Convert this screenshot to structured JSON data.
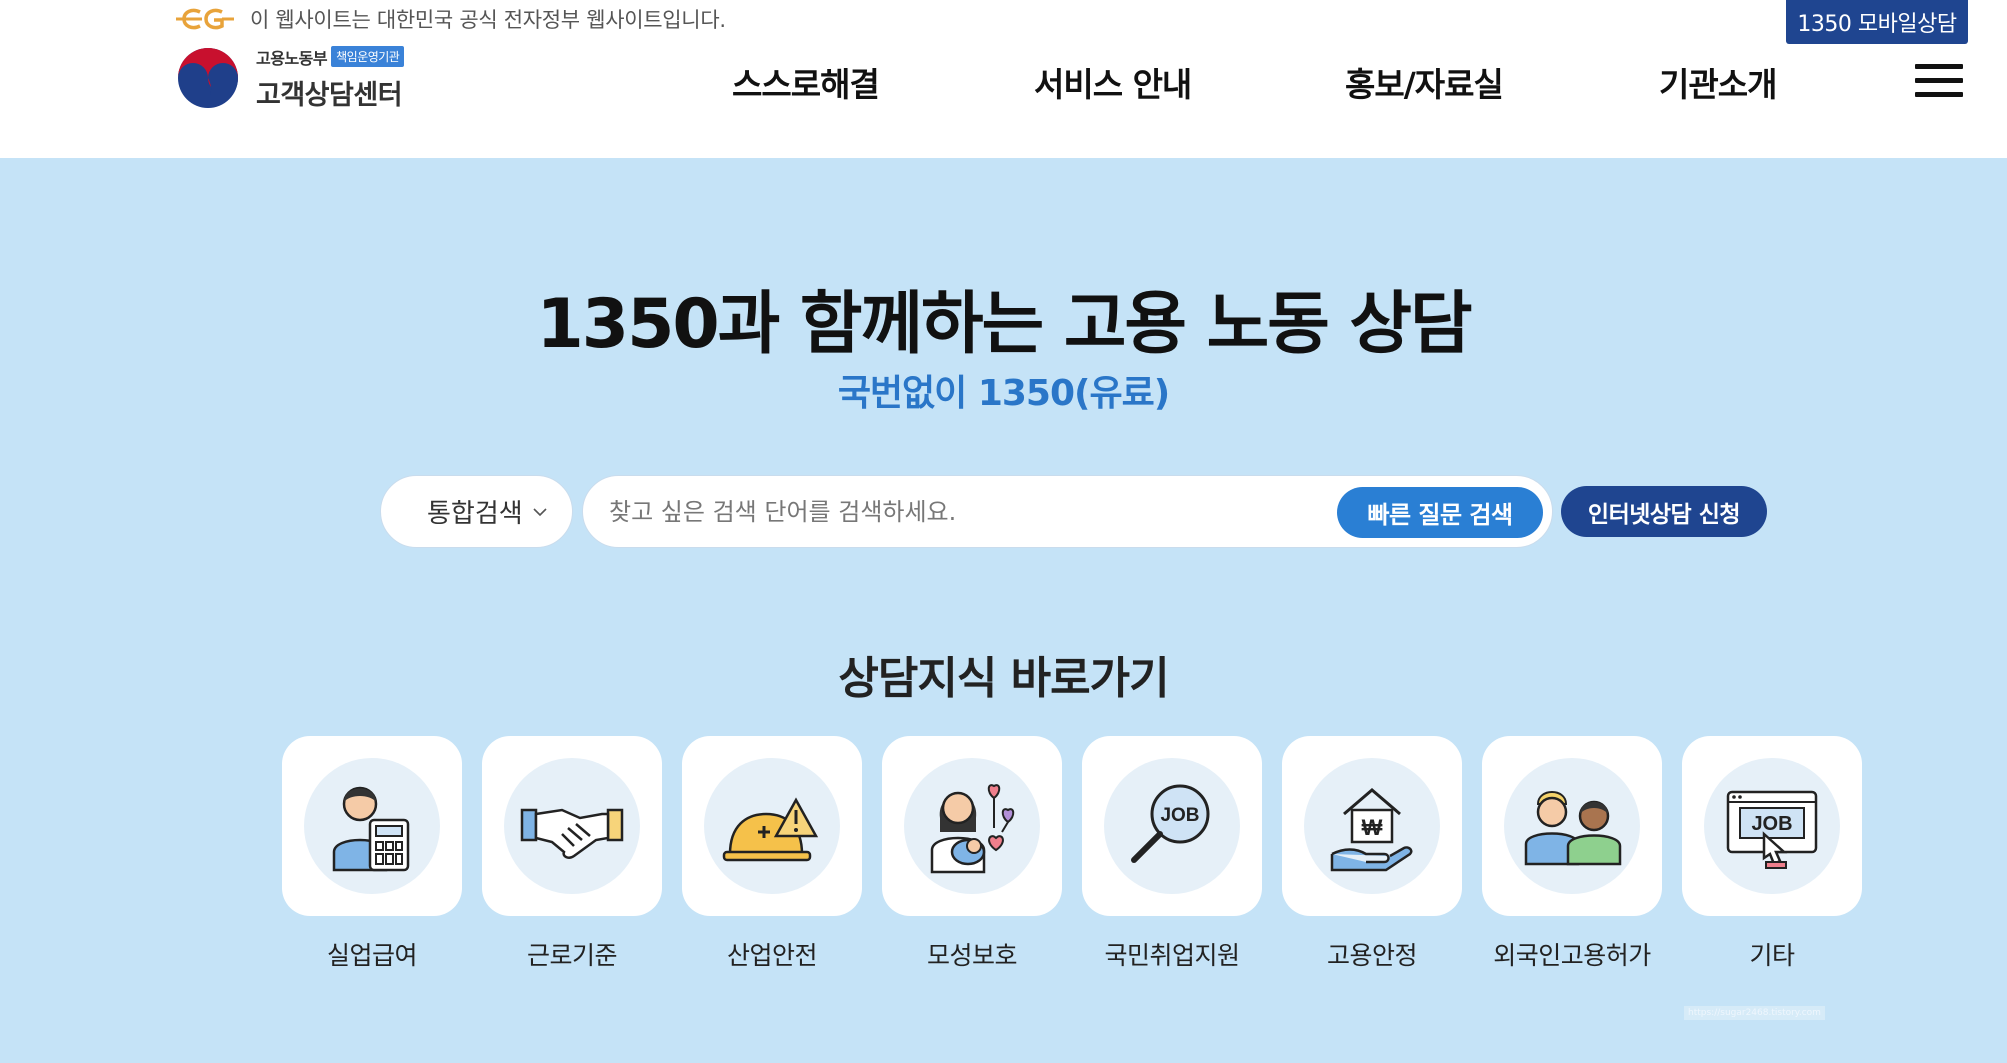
{
  "header": {
    "gov_notice": "이 웹사이트는 대한민국 공식 전자정부 웹사이트입니다.",
    "mobile_button": "1350 모바일상담",
    "logo": {
      "ministry": "고용노동부",
      "badge": "책임운영기관",
      "name": "고객상담센터"
    },
    "nav": [
      {
        "label": "스스로해결"
      },
      {
        "label": "서비스 안내"
      },
      {
        "label": "홍보/자료실"
      },
      {
        "label": "기관소개"
      }
    ]
  },
  "hero": {
    "title": "1350과 함께하는 고용 노동 상담",
    "subtitle": "국번없이 1350(유료)",
    "search": {
      "scope": "통합검색",
      "placeholder": "찾고 싶은 검색 단어를 검색하세요.",
      "value": "",
      "quick_button": "빠른 질문 검색"
    },
    "apply_button": "인터넷상담 신청"
  },
  "shortcuts": {
    "title": "상담지식 바로가기",
    "items": [
      {
        "label": "실업급여",
        "icon": "calculator-person-icon"
      },
      {
        "label": "근로기준",
        "icon": "handshake-icon"
      },
      {
        "label": "산업안전",
        "icon": "safety-helmet-icon"
      },
      {
        "label": "모성보호",
        "icon": "mother-baby-icon"
      },
      {
        "label": "국민취업지원",
        "icon": "job-search-icon"
      },
      {
        "label": "고용안정",
        "icon": "house-hand-icon"
      },
      {
        "label": "외국인고용허가",
        "icon": "two-people-icon"
      },
      {
        "label": "기타",
        "icon": "job-monitor-icon"
      }
    ]
  },
  "watermark": "https://sugar2468.tistory.com",
  "colors": {
    "hero_bg": "#c5e3f7",
    "navy": "#1f4590",
    "accent_blue": "#2a7fd4",
    "subtitle_blue": "#2a76c8"
  }
}
